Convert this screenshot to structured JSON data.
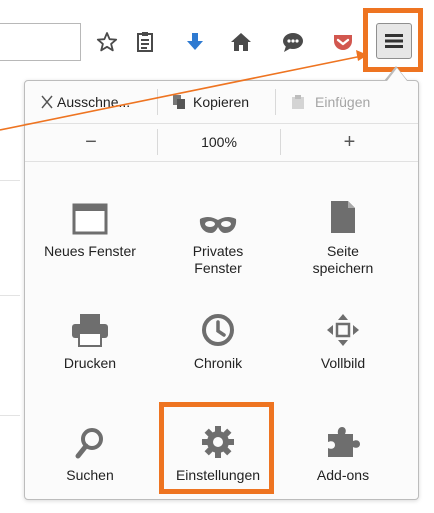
{
  "toolbar": {
    "icons": [
      "star-icon",
      "reading-list-icon",
      "download-icon",
      "home-icon",
      "chat-icon",
      "pocket-icon"
    ],
    "menu_button_icon": "hamburger-menu-icon"
  },
  "edit_row": {
    "cut_label": "Ausschne...",
    "copy_label": "Kopieren",
    "paste_label": "Einfügen"
  },
  "zoom_row": {
    "zoom_out_label": "−",
    "zoom_level": "100%",
    "zoom_in_label": "+"
  },
  "grid": {
    "items": [
      {
        "line1": "Neues Fenster",
        "line2": "",
        "icon": "window-icon"
      },
      {
        "line1": "Privates",
        "line2": "Fenster",
        "icon": "mask-icon"
      },
      {
        "line1": "Seite",
        "line2": "speichern",
        "icon": "page-icon"
      },
      {
        "line1": "Drucken",
        "line2": "",
        "icon": "printer-icon"
      },
      {
        "line1": "Chronik",
        "line2": "",
        "icon": "clock-icon"
      },
      {
        "line1": "Vollbild",
        "line2": "",
        "icon": "fullscreen-icon"
      },
      {
        "line1": "Suchen",
        "line2": "",
        "icon": "search-icon"
      },
      {
        "line1": "Einstellungen",
        "line2": "",
        "icon": "gear-icon"
      },
      {
        "line1": "Add-ons",
        "line2": "",
        "icon": "puzzle-icon"
      }
    ]
  },
  "colors": {
    "highlight": "#ee7421",
    "icon_gray": "#6e6e6e",
    "download_blue": "#2e7ad1",
    "pocket_red": "#d2574f"
  }
}
